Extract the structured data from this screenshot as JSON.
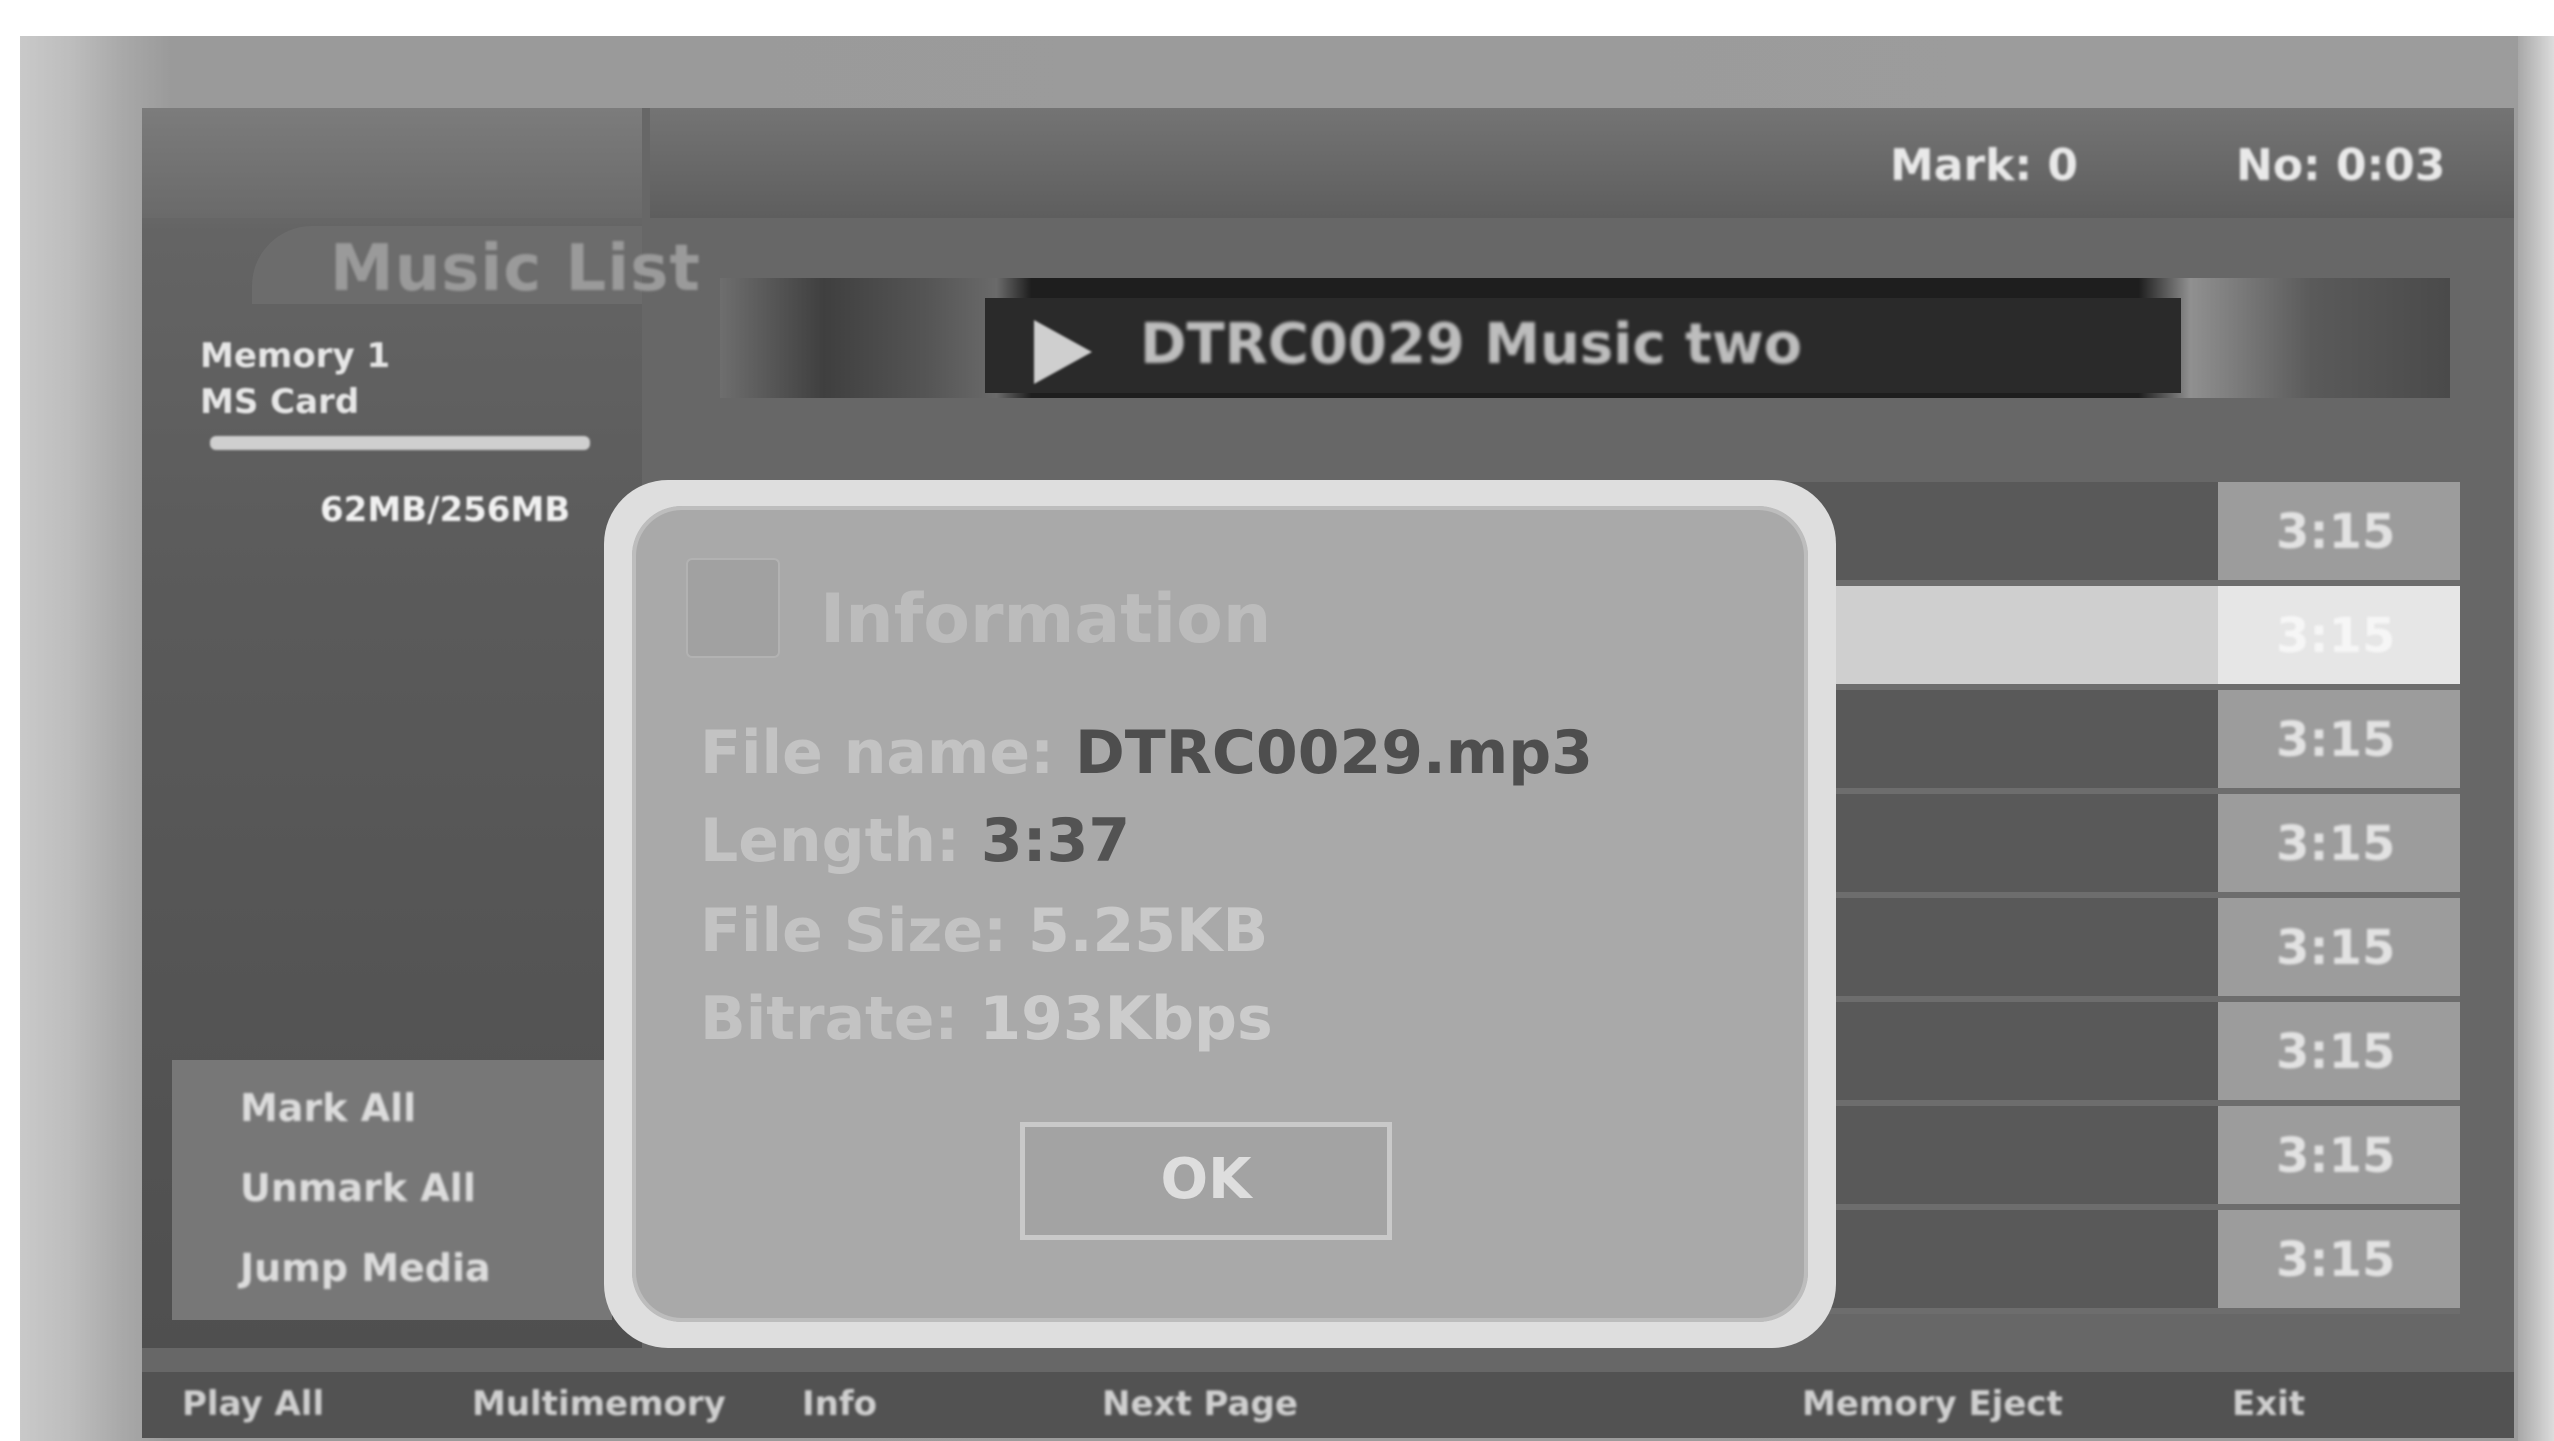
{
  "header": {
    "mark_info": "Mark: 0",
    "time_info": "No: 0:03"
  },
  "sidebar": {
    "title": "Music List",
    "memory_label": "Memory 1",
    "card_label": "MS Card",
    "storage_usage": "62MB/256MB",
    "menu_items": [
      {
        "label": "Mark All"
      },
      {
        "label": "Unmark All"
      },
      {
        "label": "Jump Media"
      }
    ]
  },
  "player": {
    "now_playing": "DTRC0029 Music two"
  },
  "tracks": [
    {
      "duration": "3:15"
    },
    {
      "duration": "3:15"
    },
    {
      "duration": "3:15"
    },
    {
      "duration": "3:15"
    },
    {
      "duration": "3:15"
    },
    {
      "duration": "3:15"
    },
    {
      "duration": "3:15"
    },
    {
      "duration": "3:15"
    }
  ],
  "dialog": {
    "title": "Information",
    "file_name_label": "File name: ",
    "file_name_value": "DTRC0029.mp3",
    "length_label": "Length: ",
    "length_value": "3:37",
    "file_size_label": "File Size: ",
    "file_size_value": "5.25KB",
    "bitrate_label": "Bitrate: ",
    "bitrate_value": "193Kbps",
    "ok_label": "OK"
  },
  "bottom_bar": {
    "play_all": "Play All",
    "multi": "Multimemory",
    "info": "Info",
    "next_page": "Next Page",
    "memory_eject": "Memory Eject",
    "exit": "Exit"
  },
  "colors": {
    "dialog_bg": "#a9a9a9",
    "dialog_border": "#dedede",
    "selected_row": "#cfcfcf"
  }
}
